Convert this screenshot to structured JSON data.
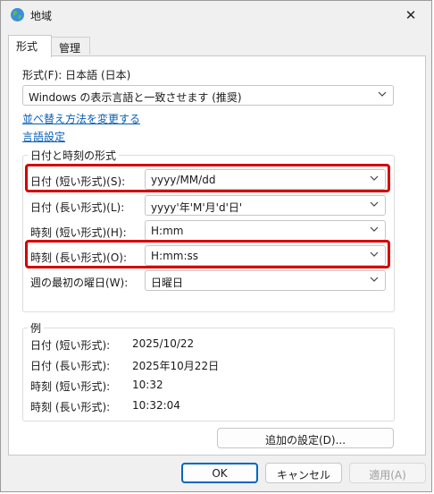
{
  "window": {
    "title": "地域",
    "close_glyph": "✕"
  },
  "tabs": [
    {
      "label": "形式"
    },
    {
      "label": "管理"
    }
  ],
  "format": {
    "label": "形式(F): 日本語 (日本)",
    "value": "Windows の表示言語と一致させます (推奨)"
  },
  "links": {
    "sort": "並べ替え方法を変更する",
    "language": "言語設定"
  },
  "datetime": {
    "group_title": "日付と時刻の形式",
    "rows": [
      {
        "label": "日付 (短い形式)(S):",
        "value": "yyyy/MM/dd"
      },
      {
        "label": "日付 (長い形式)(L):",
        "value": "yyyy'年'M'月'd'日'"
      },
      {
        "label": "時刻 (短い形式)(H):",
        "value": "H:mm"
      },
      {
        "label": "時刻 (長い形式)(O):",
        "value": "H:mm:ss"
      },
      {
        "label": "週の最初の曜日(W):",
        "value": "日曜日"
      }
    ]
  },
  "example": {
    "group_title": "例",
    "rows": [
      {
        "label": "日付 (短い形式):",
        "value": "2025/10/22"
      },
      {
        "label": "日付 (長い形式):",
        "value": "2025年10月22日"
      },
      {
        "label": "時刻 (短い形式):",
        "value": "10:32"
      },
      {
        "label": "時刻 (長い形式):",
        "value": "10:32:04"
      }
    ]
  },
  "buttons": {
    "additional": "追加の設定(D)...",
    "ok": "OK",
    "cancel": "キャンセル",
    "apply": "適用(A)"
  },
  "colors": {
    "highlight": "#d40000",
    "link": "#0a5fb4",
    "accent": "#0067c0"
  }
}
